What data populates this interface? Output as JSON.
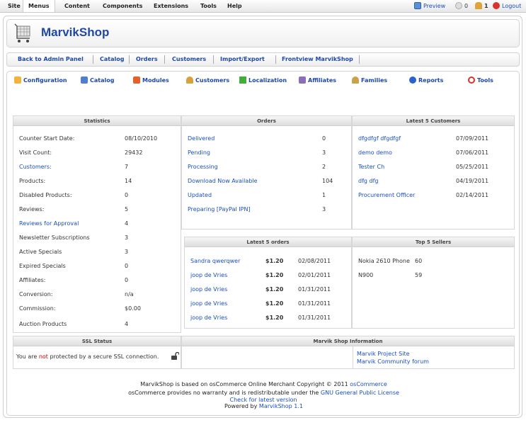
{
  "topbar": {
    "menus": [
      "Site",
      "Menus",
      "Content",
      "Components",
      "Extensions",
      "Tools",
      "Help"
    ],
    "preview": "Preview",
    "messages": "0",
    "users": "1",
    "logout": "Logout"
  },
  "brand": "MarvikShop",
  "admin_nav": [
    "Back to Admin Panel",
    "Catalog",
    "Orders",
    "Customers",
    "Import/Export",
    "Frontview MarvikShop"
  ],
  "modules": [
    "Configuration",
    "Catalog",
    "Modules",
    "Customers",
    "Localization",
    "Affiliates",
    "Families",
    "Reports",
    "Tools"
  ],
  "statistics": {
    "title": "Statistics",
    "rows": [
      {
        "label": "Counter Start Date:",
        "value": "08/10/2010",
        "link": false
      },
      {
        "label": "Visit Count:",
        "value": "29432",
        "link": false
      },
      {
        "label": "Customers:",
        "value": "7",
        "link": true
      },
      {
        "label": "Products:",
        "value": "14",
        "link": false
      },
      {
        "label": "Disabled Products:",
        "value": "0",
        "link": false
      },
      {
        "label": "Reviews:",
        "value": "5",
        "link": false
      },
      {
        "label": "Reviews for Approval",
        "value": "4",
        "link": true
      },
      {
        "label": "Newsletter Subscriptions",
        "value": "3",
        "link": false
      },
      {
        "label": "Active Specials",
        "value": "3",
        "link": false
      },
      {
        "label": "Expired Specials",
        "value": "0",
        "link": false
      },
      {
        "label": "Affiliates:",
        "value": "0",
        "link": false
      },
      {
        "label": "Conversion:",
        "value": "n/a",
        "link": false
      },
      {
        "label": "Commission:",
        "value": "$0.00",
        "link": false
      },
      {
        "label": "Auction Products",
        "value": "4",
        "link": false
      }
    ]
  },
  "orders": {
    "title": "Orders",
    "rows": [
      {
        "label": "Delivered",
        "value": "0"
      },
      {
        "label": "Pending",
        "value": "3"
      },
      {
        "label": "Processing",
        "value": "2"
      },
      {
        "label": "Download Now Available",
        "value": "104"
      },
      {
        "label": "Updated",
        "value": "1"
      },
      {
        "label": "Preparing [PayPal IPN]",
        "value": "3"
      }
    ]
  },
  "latest_customers": {
    "title": "Latest 5 Customers",
    "rows": [
      {
        "name": "dfgdfgf dfgdfgf",
        "date": "07/09/2011"
      },
      {
        "name": "demo demo",
        "date": "07/06/2011"
      },
      {
        "name": "Tester Ch",
        "date": "05/25/2011"
      },
      {
        "name": "dfg dfg",
        "date": "04/19/2011"
      },
      {
        "name": "Procurement Officer",
        "date": "02/14/2011"
      }
    ]
  },
  "latest_orders": {
    "title": "Latest 5 orders",
    "rows": [
      {
        "name": "Sandra qwerqwer",
        "amount": "$1.20",
        "date": "02/08/2011"
      },
      {
        "name": "joop de Vries",
        "amount": "$1.20",
        "date": "02/01/2011"
      },
      {
        "name": "joop de Vries",
        "amount": "$1.20",
        "date": "01/31/2011"
      },
      {
        "name": "joop de Vries",
        "amount": "$1.20",
        "date": "01/31/2011"
      },
      {
        "name": "joop de Vries",
        "amount": "$1.20",
        "date": "01/31/2011"
      }
    ]
  },
  "top_sellers": {
    "title": "Top 5 Sellers",
    "rows": [
      {
        "name": "Nokia 2610 Phone",
        "count": "60"
      },
      {
        "name": "N900",
        "count": "59"
      }
    ]
  },
  "ssl": {
    "title": "SSL Status",
    "before": "You are ",
    "not": "not",
    "after": " protected by a secure SSL connection."
  },
  "shop_info": {
    "title": "Marvik Shop Information",
    "links": [
      "Marvik Project Site",
      "Marvik Community forum"
    ]
  },
  "footer": {
    "line1_before": "MarvikShop is based on osCommerce Online Merchant Copyright © 2011 ",
    "line1_link": "osCommerce",
    "line2_before": "osCommerce provides no warranty and is redistributable under the ",
    "line2_link": "GNU General Public License",
    "powered_before": "Powered by ",
    "powered_link": "MarvikShop 1.1",
    "check": "Check for latest version"
  },
  "colors": {
    "link": "#1a4fbf",
    "brand": "#1f47a8",
    "warning": "#cc0000"
  }
}
